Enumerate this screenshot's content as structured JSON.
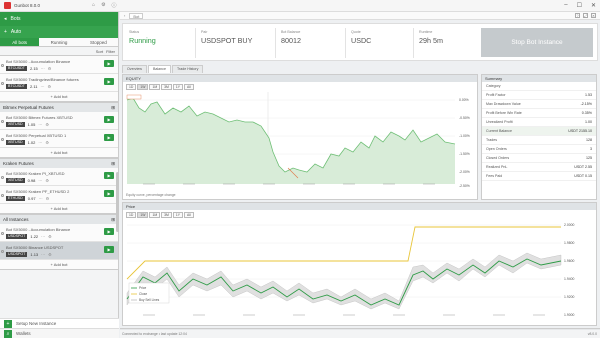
{
  "window": {
    "title": "Gunbot 8.0.0"
  },
  "left": {
    "section_title": "Bots",
    "sub_title": "Auto",
    "tabs": [
      "All bots",
      "Running",
      "Stopped"
    ],
    "mini_actions": [
      "Sort",
      "Filter"
    ],
    "groups": [
      {
        "name": "",
        "bots": [
          {
            "name": "Bot SX5000 - Accumulation Binance",
            "pill": "BTCUSDT",
            "value": "2.15",
            "selected": false
          },
          {
            "name": "Bot SX5000 Tradingview/Binance futures",
            "pill": "BTCUSDT",
            "value": "2.11",
            "selected": false
          }
        ]
      },
      {
        "name": "Bitmex Perpetual Futures",
        "bots": [
          {
            "name": "Bot SX5000 Bitmex Futures XBTUSD",
            "pill": "XBTUSD",
            "value": "1.05",
            "selected": false
          },
          {
            "name": "Bot SX5000 Perpetual XBTUSD 1",
            "pill": "XBTUSD",
            "value": "1.02",
            "selected": false
          }
        ]
      },
      {
        "name": "Kraken Futures",
        "bots": [
          {
            "name": "Bot SX5000 Kraken PI_XBTUSD",
            "pill": "XBTUSD",
            "value": "0.98",
            "selected": false
          },
          {
            "name": "Bot SX5000 Kraken PF_ETHUSD 2",
            "pill": "ETHUSD",
            "value": "0.97",
            "selected": false
          }
        ]
      },
      {
        "name": "All Instances",
        "bots": [
          {
            "name": "Bot SX5000 - Accumulation Binance",
            "pill": "USDSPOT",
            "value": "1.22",
            "selected": false
          },
          {
            "name": "Bot SX5000 Binance USDSPOT",
            "pill": "USDSPOT",
            "value": "1.13",
            "selected": true
          }
        ]
      }
    ],
    "add_label": "+ Add bot",
    "footer": [
      {
        "label": "Setup New Instance"
      },
      {
        "label": "Wallets"
      }
    ]
  },
  "main": {
    "tab": "Bot",
    "status": [
      {
        "label": "Status",
        "value": "Running",
        "green": true
      },
      {
        "label": "Pair",
        "value": "USDSPOT BUY",
        "green": false
      },
      {
        "label": "Bot Balance",
        "value": "80012",
        "green": false
      },
      {
        "label": "Quote",
        "value": "USDC",
        "green": false
      },
      {
        "label": "Runtime",
        "value": "29h 5m",
        "green": false
      }
    ],
    "stop_label": "Stop Bot Instance",
    "subtabs": [
      "Overview",
      "Balance",
      "Trade History"
    ],
    "equity": {
      "title": "EQUITY",
      "timeframes": [
        "1D",
        "1W",
        "1M",
        "3M",
        "1Y",
        "All"
      ],
      "y_ticks": [
        "0.00%",
        "-0.50%",
        "-1.00%",
        "-1.50%",
        "-2.00%",
        "-2.50%"
      ],
      "footer": "Equity curve, percentage change"
    },
    "summary": {
      "title": "Summary",
      "rows": [
        {
          "k": "Category",
          "v": ""
        },
        {
          "k": "Profit Factor",
          "v": "1.53"
        },
        {
          "k": "Max Drawdown Value",
          "v": "-2.15%"
        },
        {
          "k": "Profit Before Win Rate",
          "v": "0.35%"
        },
        {
          "k": "Unrealized Profit",
          "v": "1.00"
        },
        {
          "k": "Current Balance",
          "v": "USDT 2155.10"
        },
        {
          "k": "Trades",
          "v": "128"
        },
        {
          "k": "Open Orders",
          "v": "3"
        },
        {
          "k": "Closed Orders",
          "v": "125"
        },
        {
          "k": "Realized PnL",
          "v": "USDT 2.55"
        },
        {
          "k": "Fees Paid",
          "v": "USDT 0.15"
        }
      ]
    },
    "price": {
      "title": "Price",
      "timeframes": [
        "1D",
        "1W",
        "1M",
        "3M",
        "1Y",
        "All"
      ],
      "y_ticks": [
        "2.0000",
        "1.9800",
        "1.9600",
        "1.9400",
        "1.9200",
        "1.9000"
      ],
      "legend": [
        "Price",
        "Close",
        "Buy Sell Lines"
      ]
    },
    "bottombar": "Transaction history",
    "footstat_left": "Connected to exchange • last update 12:04",
    "footstat_right": "v8.0.0"
  }
}
